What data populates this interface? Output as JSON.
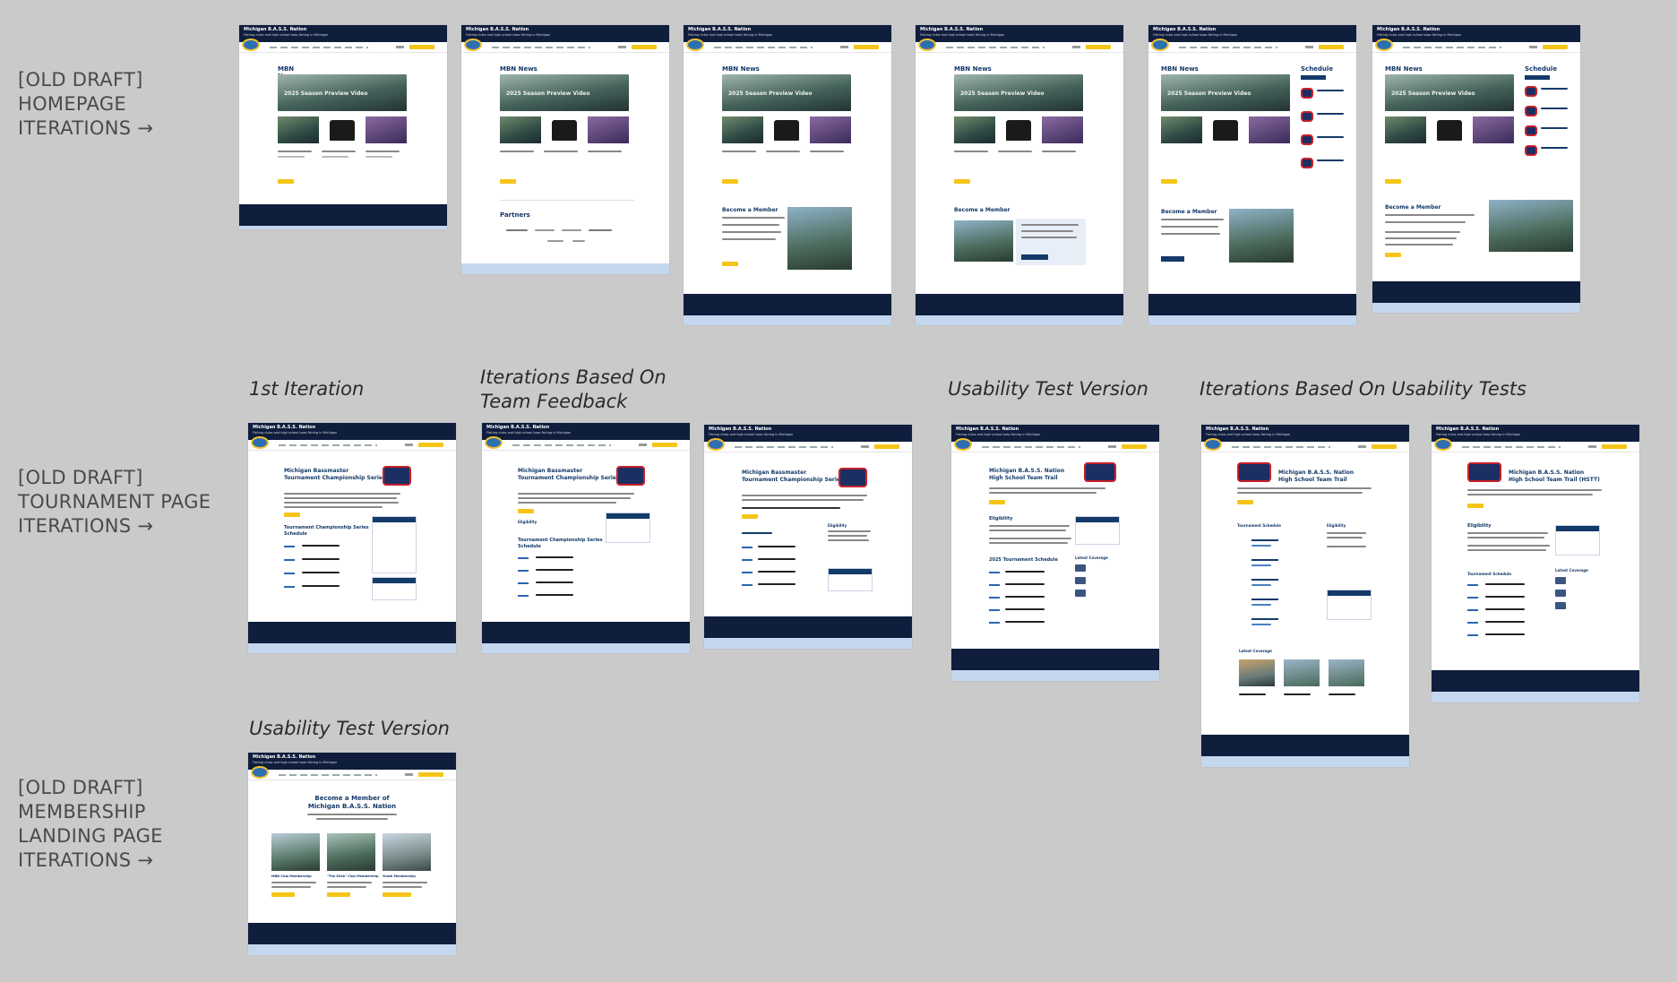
{
  "rows": [
    {
      "label": "[OLD DRAFT]\nHOMEPAGE\nITERATIONS →"
    },
    {
      "label": "[OLD DRAFT]\nTOURNAMENT PAGE\nITERATIONS →"
    },
    {
      "label": "[OLD DRAFT]\nMEMBERSHIP\nLANDING PAGE\nITERATIONS →"
    }
  ],
  "captions": {
    "first": "1st Iteration",
    "team": "Iterations Based On\nTeam Feedback",
    "usability_t": "Usability Test Version",
    "after_usability": "Iterations Based On Usability Tests",
    "usability_m": "Usability Test Version"
  },
  "site": {
    "name": "Michigan B.A.S.S. Nation",
    "tagline": "Fishing clubs and high school bass fishing in Michigan"
  },
  "home": {
    "news_heading": "MBN News",
    "video_title": "2025 Season Preview Video",
    "schedule_heading": "Schedule",
    "partners_heading": "Partners",
    "member_heading": "Become a Member"
  },
  "tournament": {
    "title_a": "Michigan Bassmaster\nTournament Championship Series",
    "title_b": "Michigan B.A.S.S. Nation\nHigh School Team Trail",
    "title_c": "Michigan B.A.S.S. Nation\nHigh School Team Trail (HSTT)",
    "eligibility": "Eligibility",
    "schedule_a": "Tournament Championship Series\nSchedule",
    "schedule_b": "2025 Tournament Schedule",
    "schedule_c": "Tournament Schedule",
    "coverage": "Latest Coverage"
  },
  "membership": {
    "title": "Become a Member of\nMichigan B.A.S.S. Nation",
    "club": "MBN Club Membership",
    "stick": "\"The Stick\" Club Membership",
    "youth": "Youth Membership"
  }
}
